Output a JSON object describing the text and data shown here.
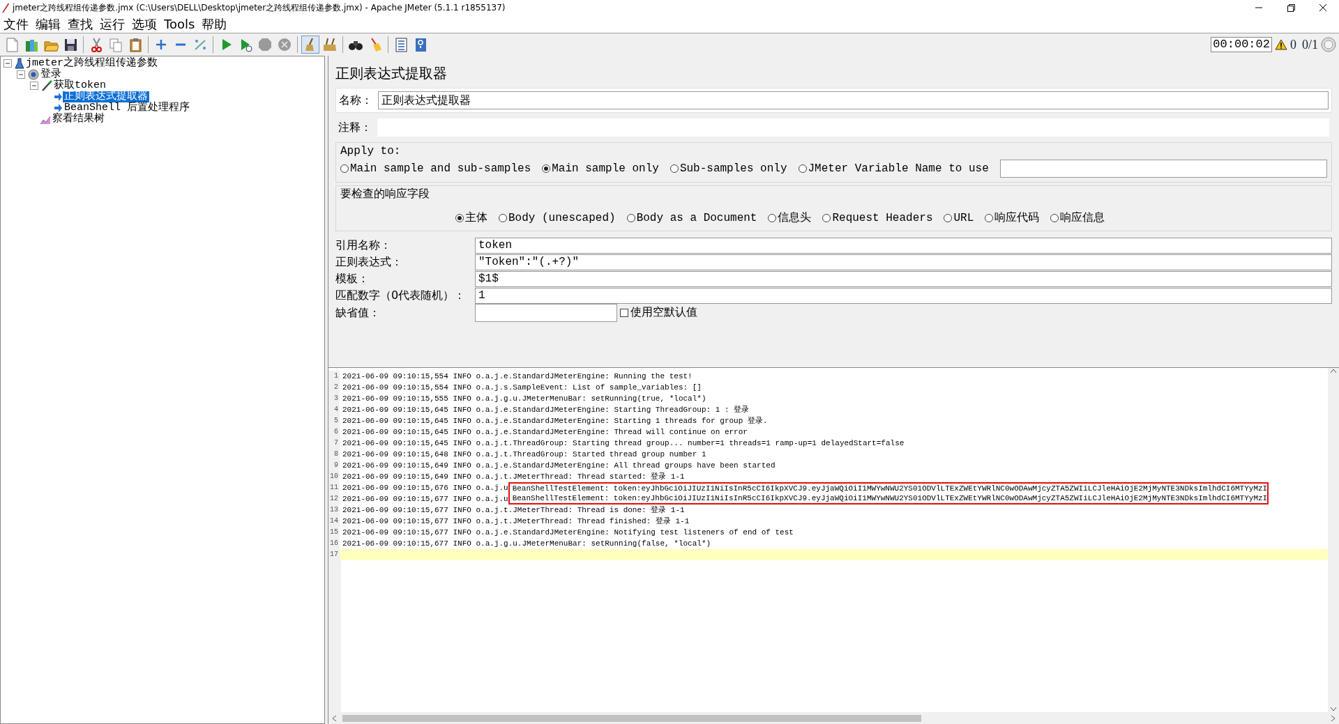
{
  "window": {
    "title": "jmeter之跨线程组传递参数.jmx (C:\\Users\\DELL\\Desktop\\jmeter之跨线程组传递参数.jmx) - Apache JMeter (5.1.1 r1855137)"
  },
  "menu": [
    "文件",
    "编辑",
    "查找",
    "运行",
    "选项",
    "Tools",
    "帮助"
  ],
  "status": {
    "timer": "00:00:02",
    "warnings": "0",
    "threads": "0/1"
  },
  "tree": [
    {
      "label": "jmeter之跨线程组传递参数",
      "kind": "plan",
      "expanded": true,
      "selected": false,
      "children": [
        {
          "label": "登录",
          "kind": "group",
          "expanded": true,
          "selected": false,
          "children": [
            {
              "label": "获取token",
              "kind": "sampler",
              "expanded": true,
              "selected": false,
              "children": [
                {
                  "label": "正则表达式提取器",
                  "kind": "post",
                  "selected": true
                },
                {
                  "label": "BeanShell 后置处理程序",
                  "kind": "post",
                  "selected": false
                }
              ]
            },
            {
              "label": "察看结果树",
              "kind": "listener",
              "selected": false
            }
          ]
        }
      ]
    }
  ],
  "form": {
    "title": "正则表达式提取器",
    "name_label": "名称：",
    "name_value": "正则表达式提取器",
    "comment_label": "注释：",
    "apply_to": {
      "legend": "Apply to:",
      "options": [
        {
          "label": "Main sample and sub-samples",
          "selected": false
        },
        {
          "label": "Main sample only",
          "selected": true
        },
        {
          "label": "Sub-samples only",
          "selected": false
        },
        {
          "label": "JMeter Variable Name to use",
          "selected": false
        }
      ]
    },
    "field_to_check": {
      "legend": "要检查的响应字段",
      "options": [
        {
          "label": "主体",
          "selected": true
        },
        {
          "label": "Body (unescaped)",
          "selected": false
        },
        {
          "label": "Body as a Document",
          "selected": false
        },
        {
          "label": "信息头",
          "selected": false
        },
        {
          "label": "Request Headers",
          "selected": false
        },
        {
          "label": "URL",
          "selected": false
        },
        {
          "label": "响应代码",
          "selected": false
        },
        {
          "label": "响应信息",
          "selected": false
        }
      ]
    },
    "rows": [
      {
        "label": "引用名称：",
        "value": "token"
      },
      {
        "label": "正则表达式：",
        "value": "\"Token\":\"(.+?)\""
      },
      {
        "label": "模板：",
        "value": "$1$"
      },
      {
        "label": "匹配数字（0代表随机）：",
        "value": "1"
      }
    ],
    "default_label": "缺省值：",
    "empty_default": {
      "label": "使用空默认值",
      "checked": false
    }
  },
  "log": [
    {
      "number": "1",
      "text": "2021-06-09 09:10:15,554 INFO o.a.j.e.StandardJMeterEngine: Running the test!",
      "current": false
    },
    {
      "number": "2",
      "text": "2021-06-09 09:10:15,554 INFO o.a.j.s.SampleEvent: List of sample_variables: []",
      "current": false
    },
    {
      "number": "3",
      "text": "2021-06-09 09:10:15,555 INFO o.a.j.g.u.JMeterMenuBar: setRunning(true, *local*)",
      "current": false
    },
    {
      "number": "4",
      "text": "2021-06-09 09:10:15,645 INFO o.a.j.e.StandardJMeterEngine: Starting ThreadGroup: 1 : 登录",
      "current": false
    },
    {
      "number": "5",
      "text": "2021-06-09 09:10:15,645 INFO o.a.j.e.StandardJMeterEngine: Starting 1 threads for group 登录.",
      "current": false
    },
    {
      "number": "6",
      "text": "2021-06-09 09:10:15,645 INFO o.a.j.e.StandardJMeterEngine: Thread will continue on error",
      "current": false
    },
    {
      "number": "7",
      "text": "2021-06-09 09:10:15,645 INFO o.a.j.t.ThreadGroup: Starting thread group... number=1 threads=1 ramp-up=1 delayedStart=false",
      "current": false
    },
    {
      "number": "8",
      "text": "2021-06-09 09:10:15,648 INFO o.a.j.t.ThreadGroup: Started thread group number 1",
      "current": false
    },
    {
      "number": "9",
      "text": "2021-06-09 09:10:15,649 INFO o.a.j.e.StandardJMeterEngine: All thread groups have been started",
      "current": false
    },
    {
      "number": "10",
      "text": "2021-06-09 09:10:15,649 INFO o.a.j.t.JMeterThread: Thread started: 登录 1-1",
      "current": false
    },
    {
      "number": "11",
      "text": "2021-06-09 09:10:15,676 INFO o.a.j.u",
      "boxed": "BeanShellTestElement: token:eyJhbGciOiJIUzI1NiIsInR5cCI6IkpXVCJ9.eyJjaWQiOiI1MWYwNWU2YS01ODVlLTExZWEtYWRlNC0wODAwMjcyZTA5ZWIiLCJleHAiOjE2MjMyNTE3NDksImlhdCI6MTYyMzI",
      "current": false
    },
    {
      "number": "12",
      "text": "2021-06-09 09:10:15,677 INFO o.a.j.u",
      "boxed": "BeanShellTestElement: token:eyJhbGciOiJIUzI1NiIsInR5cCI6IkpXVCJ9.eyJjaWQiOiI1MWYwNWU2YS01ODVlLTExZWEtYWRlNC0wODAwMjcyZTA5ZWIiLCJleHAiOjE2MjMyNTE3NDksImlhdCI6MTYyMzI",
      "current": false
    },
    {
      "number": "13",
      "text": "2021-06-09 09:10:15,677 INFO o.a.j.t.JMeterThread: Thread is done: 登录 1-1",
      "current": false
    },
    {
      "number": "14",
      "text": "2021-06-09 09:10:15,677 INFO o.a.j.t.JMeterThread: Thread finished: 登录 1-1",
      "current": false
    },
    {
      "number": "15",
      "text": "2021-06-09 09:10:15,677 INFO o.a.j.e.StandardJMeterEngine: Notifying test listeners of end of test",
      "current": false
    },
    {
      "number": "16",
      "text": "2021-06-09 09:10:15,677 INFO o.a.j.g.u.JMeterMenuBar: setRunning(false, *local*)",
      "current": false
    },
    {
      "number": "17",
      "current": true
    }
  ]
}
